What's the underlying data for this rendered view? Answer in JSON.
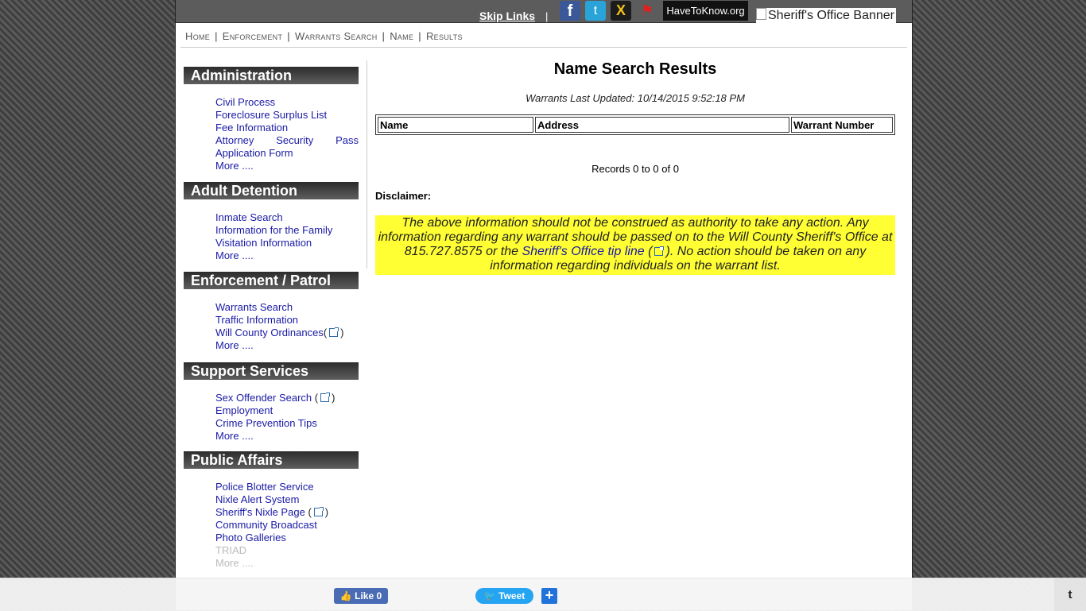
{
  "topbar": {
    "skip_links": "Skip Links",
    "pipe": "|",
    "facebook_glyph": "f",
    "twitter_glyph": "t",
    "nixle_glyph": "X",
    "flag_glyph": "⚑",
    "havetoknow": "HaveToKnow.org",
    "banner_alt": "Sheriff's Office Banner"
  },
  "breadcrumb": {
    "items": [
      "Home",
      "Enforcement",
      "Warrants Search",
      "Name",
      "Results"
    ],
    "sep": "|"
  },
  "sidebar": {
    "sections": [
      {
        "title": "Administration",
        "items": [
          "Civil Process",
          "Foreclosure Surplus List",
          "Fee Information"
        ],
        "attorney": [
          "Attorney",
          "Security",
          "Pass"
        ],
        "attorney_cont": "Application Form",
        "more": "More ...."
      },
      {
        "title": "Adult Detention",
        "items": [
          "Inmate Search",
          "Information for the Family",
          "Visitation Information"
        ],
        "more": "More ...."
      },
      {
        "title": "Enforcement / Patrol",
        "items": [
          "Warrants Search",
          "Traffic Information"
        ],
        "ext_item": "Will County Ordinances",
        "more": "More ...."
      },
      {
        "title": "Support Services",
        "ext_item": "Sex Offender Search",
        "items": [
          "Employment",
          "Crime Prevention Tips"
        ],
        "more": "More ...."
      },
      {
        "title": "Public Affairs",
        "items": [
          "Police Blotter Service",
          "Nixle Alert System"
        ],
        "ext_item": "Sheriff's Nixle Page",
        "items2": [
          "Community Broadcast",
          "Photo Galleries",
          "TRIAD"
        ],
        "more": "More ...."
      }
    ]
  },
  "main": {
    "title": "Name Search Results",
    "updated": "Warrants Last Updated: 10/14/2015 9:52:18 PM",
    "table": {
      "headers": [
        "Name",
        "Address",
        "Warrant Number"
      ]
    },
    "records": "Records 0 to 0 of 0",
    "disclaimer_label": "Disclaimer:",
    "disclaimer": {
      "part1": "The above information should not be construed as authority to take any action. Any information regarding any warrant should be passed on to the Will County Sheriff's Office at 815.727.8575 or the ",
      "link": "Sheriff's Office tip line",
      "part2": ". No action should be taken on any information regarding individuals on the warrant list."
    }
  },
  "bottombar": {
    "like": "👍 Like 0",
    "tweet": "🐦 Tweet",
    "share": "+",
    "t_button": "t"
  }
}
